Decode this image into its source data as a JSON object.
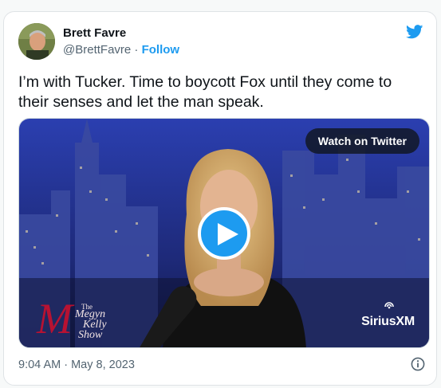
{
  "tweet": {
    "author_name": "Brett Favre",
    "handle": "@BrettFavre",
    "separator": "·",
    "follow_label": "Follow",
    "text": "I’m with Tucker. Time to boycott Fox until they come to their senses and let the man speak.",
    "timestamp": "9:04 AM · May 8, 2023"
  },
  "media": {
    "watch_label": "Watch on Twitter",
    "show_logo": {
      "the": "The",
      "line1": "Megyn",
      "line2": "Kelly",
      "line3": "Show"
    },
    "network_logo": "SiriusXM"
  },
  "icons": {
    "brand": "twitter-bird-icon",
    "play": "play-icon",
    "info": "info-icon"
  },
  "colors": {
    "accent": "#1d9bf0",
    "text_secondary": "#536471"
  }
}
